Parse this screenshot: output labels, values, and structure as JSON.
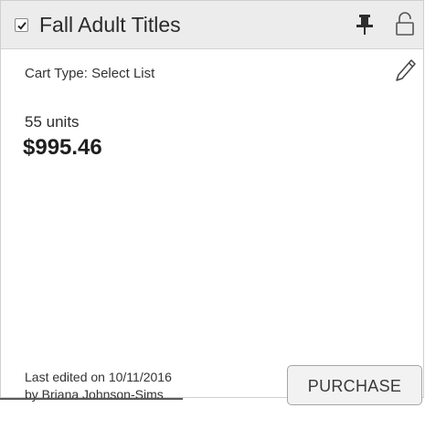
{
  "card": {
    "title": "Fall Adult Titles",
    "checked": true,
    "cart_type_label": "Cart Type: Select List",
    "units": "55 units",
    "total": "$995.46",
    "last_edited_line1": "Last edited on 10/11/2016",
    "last_edited_line2": "by Briana Johnson-Sims",
    "purchase_label": "PURCHASE"
  },
  "icons": {
    "checkbox": "checkmark-icon",
    "pin": "pin-icon",
    "lock": "unlock-icon",
    "edit": "pencil-icon"
  },
  "colors": {
    "header_bg": "#ececec",
    "text": "#2b2b2b",
    "button_bg": "#f2f2f2"
  }
}
